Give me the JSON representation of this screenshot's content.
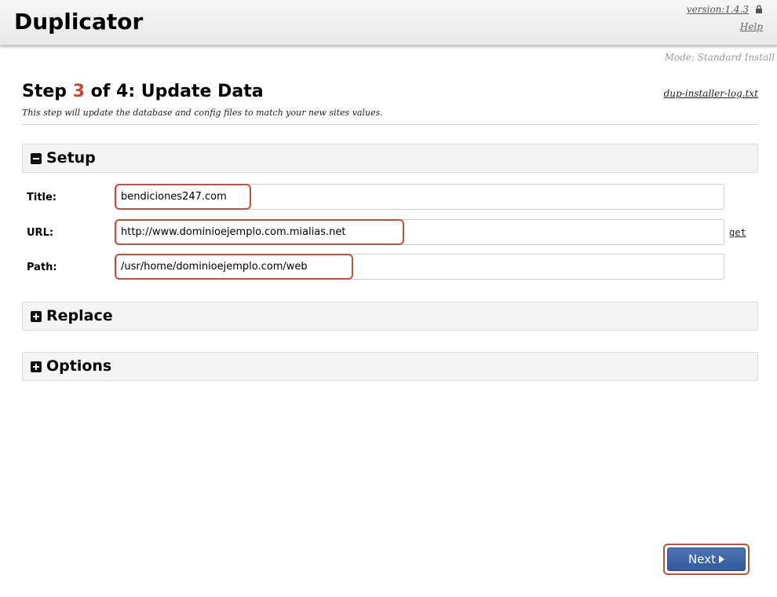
{
  "header": {
    "app_title": "Duplicator",
    "version": "version:1.4.3",
    "help": "Help",
    "lock_icon": "lock-icon"
  },
  "mode": "Mode: Standard Install",
  "step": {
    "prefix": "Step ",
    "number": "3",
    "suffix": " of 4: Update Data",
    "description": "This step will update the database and config files to match your new sites values.",
    "log_link": "dup-installer-log.txt",
    "accent_color": "#c24a3a"
  },
  "sections": {
    "setup": {
      "label": "Setup",
      "state": "expanded",
      "icon": "minus-square-icon"
    },
    "replace": {
      "label": "Replace",
      "state": "collapsed",
      "icon": "plus-square-icon"
    },
    "options": {
      "label": "Options",
      "state": "collapsed",
      "icon": "plus-square-icon"
    }
  },
  "fields": {
    "title": {
      "label": "Title:",
      "value": "bendiciones247.com"
    },
    "url": {
      "label": "URL:",
      "value": "http://www.dominioejemplo.com.mialias.net",
      "get_link": "get"
    },
    "path": {
      "label": "Path:",
      "value": "/usr/home/dominioejemplo.com/web"
    }
  },
  "highlight_color": "#c0503d",
  "next_button": {
    "label": "Next",
    "icon": "caret-right-icon",
    "color": "#3f66a8"
  }
}
